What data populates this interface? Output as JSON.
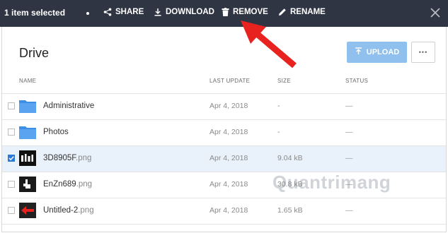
{
  "topbar": {
    "selection_label": "1 item selected",
    "actions": [
      {
        "label": "SHARE",
        "icon": "share-icon"
      },
      {
        "label": "DOWNLOAD",
        "icon": "download-icon"
      },
      {
        "label": "REMOVE",
        "icon": "trash-icon"
      },
      {
        "label": "RENAME",
        "icon": "pencil-icon"
      }
    ]
  },
  "header": {
    "title": "Drive",
    "upload_label": "UPLOAD",
    "more_label": "•••"
  },
  "columns": {
    "name": "NAME",
    "last_update": "LAST UPDATE",
    "size": "SIZE",
    "status": "STATUS"
  },
  "files": [
    {
      "base": "Administrative",
      "ext": "",
      "date": "Apr 4, 2018",
      "size": "-",
      "status": "—",
      "type": "folder",
      "selected": false
    },
    {
      "base": "Photos",
      "ext": "",
      "date": "Apr 4, 2018",
      "size": "-",
      "status": "—",
      "type": "folder",
      "selected": false
    },
    {
      "base": "3D8905F",
      "ext": ".png",
      "date": "Apr 4, 2018",
      "size": "9.04 kB",
      "status": "—",
      "type": "image",
      "selected": true
    },
    {
      "base": "EnZn689",
      "ext": ".png",
      "date": "Apr 4, 2018",
      "size": "30.8 kB",
      "status": "—",
      "type": "image",
      "selected": false
    },
    {
      "base": "Untitled-2",
      "ext": ".png",
      "date": "Apr 4, 2018",
      "size": "1.65 kB",
      "status": "—",
      "type": "image",
      "selected": false
    }
  ],
  "watermark": "Quantrimang",
  "colors": {
    "topbar": "#2f3542",
    "accent": "#2c7ad6",
    "upload": "#90c0ee",
    "arrow": "#e8231f"
  }
}
